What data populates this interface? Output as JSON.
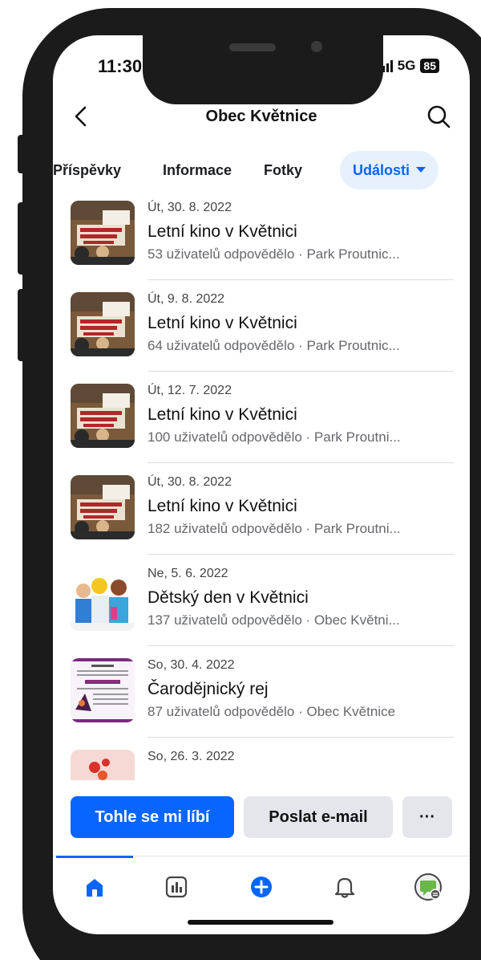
{
  "status_bar": {
    "time": "11:30",
    "network": "5G",
    "battery": "85"
  },
  "header": {
    "title": "Obec Květnice",
    "back_icon": "chevron-left-icon",
    "search_icon": "search-icon"
  },
  "tabs": [
    {
      "label": "Příspěvky"
    },
    {
      "label": "Informace"
    },
    {
      "label": "Fotky"
    },
    {
      "label": "Události",
      "active": true
    }
  ],
  "events": [
    {
      "date": "Út, 30. 8. 2022",
      "title": "Letní kino v Květnici",
      "meta": "53 uživatelů odpovědělo · Park Proutnic..."
    },
    {
      "date": "Út, 9. 8. 2022",
      "title": "Letní kino v Květnici",
      "meta": "64 uživatelů odpovědělo · Park Proutnic..."
    },
    {
      "date": "Út, 12. 7. 2022",
      "title": "Letní kino v Květnici",
      "meta": "100 uživatelů odpovědělo · Park Proutni..."
    },
    {
      "date": "Út, 30. 8. 2022",
      "title": "Letní kino v Květnici",
      "meta": "182 uživatelů odpovědělo · Park Proutni..."
    },
    {
      "date": "Ne, 5. 6. 2022",
      "title": "Dětský den v Květnici",
      "meta": "137 uživatelů odpovědělo · Obec Květni..."
    },
    {
      "date": "So, 30. 4. 2022",
      "title": "Čarodějnický rej",
      "meta": "87 uživatelů odpovědělo · Obec Květnice"
    },
    {
      "date": "So, 26. 3. 2022",
      "title": "",
      "meta": ""
    }
  ],
  "actions": {
    "like_label": "Tohle se mi líbí",
    "email_label": "Poslat e-mail",
    "more_label": "···"
  },
  "bottom_nav": [
    "home-icon",
    "dashboard-icon",
    "create-icon",
    "notifications-icon",
    "profile-avatar-icon"
  ],
  "colors": {
    "accent": "#0866ff",
    "tab_active_bg": "#e7f0fd",
    "secondary_button": "#e4e6eb",
    "muted_text": "#65676b"
  }
}
